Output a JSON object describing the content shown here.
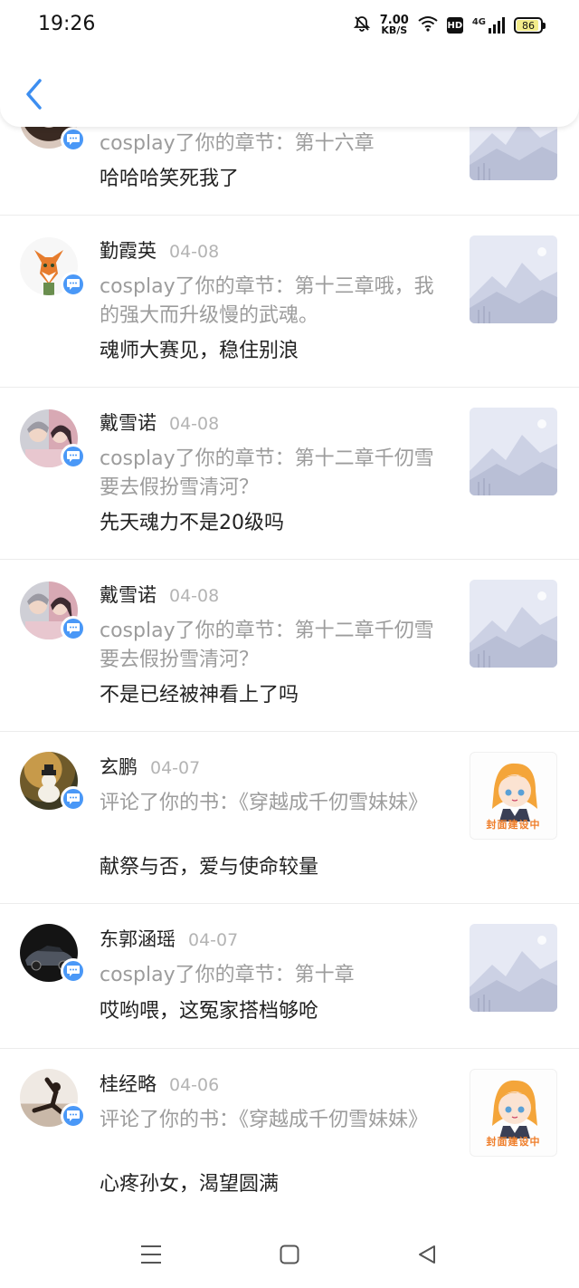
{
  "status_bar": {
    "time": "19:26",
    "net_speed": "7.00",
    "net_unit": "KB/S",
    "hd": "HD",
    "network": "4G",
    "battery": "86",
    "battery_level": 0.86
  },
  "items": [
    {
      "name": "",
      "date": "",
      "desc": "cosplay了你的章节：第十六章",
      "content": "哈哈哈笑死我了",
      "thumb": "landscape"
    },
    {
      "name": "勤霞英",
      "date": "04-08",
      "desc": "cosplay了你的章节：第十三章哦，我的强大而升级慢的武魂。",
      "content": "魂师大赛见，稳住别浪",
      "thumb": "landscape"
    },
    {
      "name": "戴雪诺",
      "date": "04-08",
      "desc": "cosplay了你的章节：第十二章千仞雪要去假扮雪清河？",
      "content": "先天魂力不是20级吗",
      "thumb": "landscape"
    },
    {
      "name": "戴雪诺",
      "date": "04-08",
      "desc": "cosplay了你的章节：第十二章千仞雪要去假扮雪清河？",
      "content": "不是已经被神看上了吗",
      "thumb": "landscape"
    },
    {
      "name": "玄鹏",
      "date": "04-07",
      "desc": "评论了你的书：《穿越成千仞雪妹妹》",
      "content": "献祭与否，爱与使命较量",
      "thumb": "cover"
    },
    {
      "name": "东郭涵瑶",
      "date": "04-07",
      "desc": "cosplay了你的章节：第十章",
      "content": "哎哟喂，这冤家搭档够呛",
      "thumb": "landscape"
    },
    {
      "name": "桂经略",
      "date": "04-06",
      "desc": "评论了你的书：《穿越成千仞雪妹妹》",
      "content": "心疼孙女，渴望圆满",
      "thumb": "cover"
    }
  ],
  "cover_wip_label": "封面建设中",
  "colors": {
    "badge": "#4a98f7",
    "accent_back": "#3d8ef0"
  }
}
